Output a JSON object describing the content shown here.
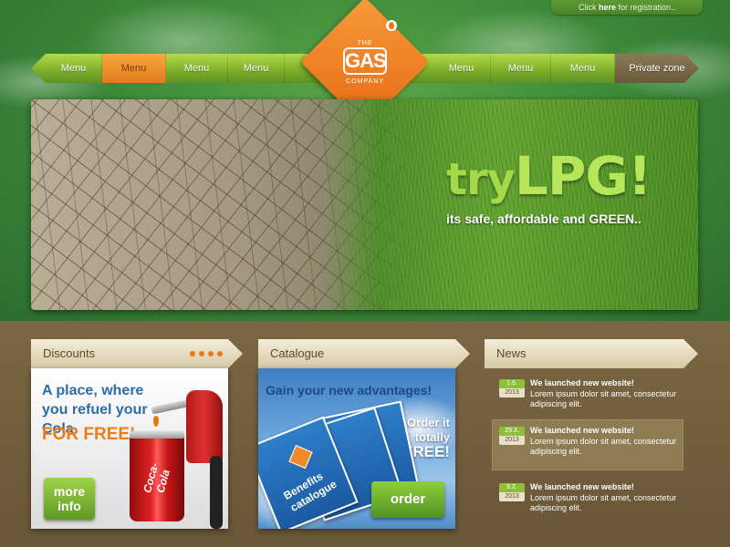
{
  "topbar": {
    "reg_prefix": "Click ",
    "reg_link": "here",
    "reg_suffix": " for registration.."
  },
  "logo": {
    "the": "THE",
    "gas": "GAS",
    "company": "COMPANY"
  },
  "nav": {
    "items": [
      "Menu",
      "Menu",
      "Menu",
      "Menu",
      "Menu",
      "Menu",
      "Menu"
    ],
    "private": "Private zone"
  },
  "hero": {
    "try": "try",
    "lpg": "LPG!",
    "tagline": "its safe, affordable and GREEN.."
  },
  "discounts": {
    "heading": "Discounts",
    "title": "A place, where you refuel your Cola",
    "free": "FOR FREE!",
    "more_line1": "more",
    "more_line2": "info",
    "can_brand": "Coca-Cola"
  },
  "catalogue": {
    "heading": "Catalogue",
    "title": "Gain your new advantages!",
    "order_text_line1": "Order it",
    "order_text_line2": "totally",
    "order_text_line3": "FREE!",
    "book_label": "Benefits catalogue",
    "order_btn": "order"
  },
  "news": {
    "heading": "News",
    "items": [
      {
        "day": "1.6.",
        "year": "2013",
        "title": "We launched new website!",
        "text": "Lorem ipsum dolor sit amet, consectetur adipiscing elit."
      },
      {
        "day": "29.3.",
        "year": "2013",
        "title": "We launched new website!",
        "text": "Lorem ipsum dolor sit amet, consectetur adipiscing elit."
      },
      {
        "day": "5.2.",
        "year": "2013",
        "title": "We launched new website!",
        "text": "Lorem ipsum dolor sit amet, consectetur adipiscing elit."
      }
    ]
  },
  "colors": {
    "accent_orange": "#e87a1c",
    "accent_green": "#7fb22b",
    "brown": "#6e5a3a"
  }
}
